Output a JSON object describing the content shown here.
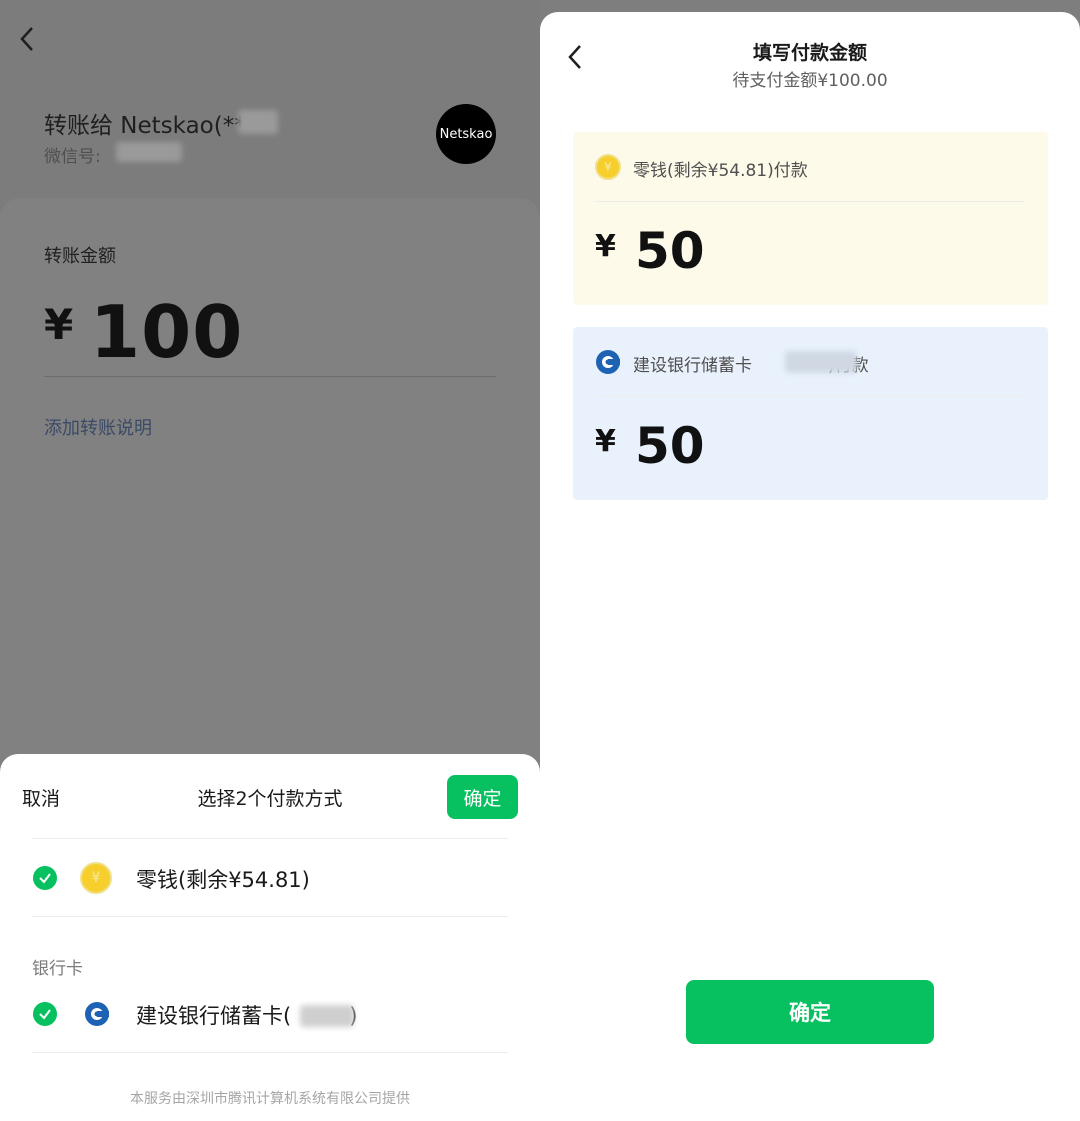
{
  "transfer": {
    "title": "转账给  Netskao(**",
    "wechat_id_label": "微信号:",
    "avatar_text": "Netskao",
    "amount_label": "转账金额",
    "currency": "¥",
    "amount": "100",
    "add_note": "添加转账说明"
  },
  "sheet": {
    "cancel": "取消",
    "title": "选择2个付款方式",
    "confirm": "确定",
    "balance_item": "零钱(剩余¥54.81)",
    "bank_section": "银行卡",
    "bank_item_prefix": "建设银行储蓄卡(",
    "bank_item_suffix": ")",
    "footer": "本服务由深圳市腾讯计算机系统有限公司提供"
  },
  "fill": {
    "title": "填写付款金额",
    "subtitle": "待支付金额¥100.00",
    "balance_label": "零钱(剩余¥54.81)付款",
    "balance_currency": "¥",
    "balance_amount": "50",
    "bank_label_prefix": "建设银行储蓄卡",
    "bank_label_suffix": ")付款",
    "bank_currency": "¥",
    "bank_amount": "50",
    "confirm": "确定"
  },
  "colors": {
    "accent_green": "#07c160",
    "coin_yellow": "#f6cf2c",
    "ccb_blue": "#1e62b3"
  }
}
